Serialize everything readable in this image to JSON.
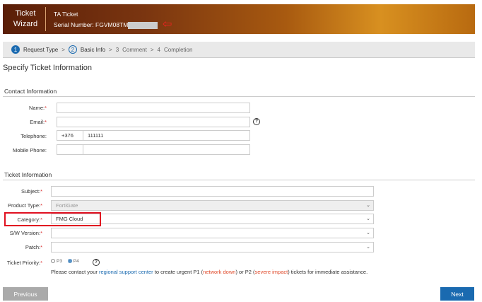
{
  "banner": {
    "title_line1": "Ticket",
    "title_line2": "Wizard",
    "ticket_type": "TA Ticket",
    "serial_label": "Serial Number: FGVM08TM"
  },
  "steps": [
    {
      "num": "1",
      "label": "Request Type"
    },
    {
      "num": "2",
      "label": "Basic Info"
    },
    {
      "num": "3",
      "label": "Comment"
    },
    {
      "num": "4",
      "label": "Completion"
    }
  ],
  "separator": ">",
  "page_title": "Specify Ticket Information",
  "contact": {
    "heading": "Contact Information",
    "name_label": "Name:",
    "email_label": "Email:",
    "telephone_label": "Telephone:",
    "telephone_code": "+376",
    "telephone_number": "111111",
    "mobile_label": "Mobile Phone:"
  },
  "ticket": {
    "heading": "Ticket Information",
    "subject_label": "Subject:",
    "product_label": "Product Type:",
    "product_value": "FortiGate",
    "category_label": "Category:",
    "category_value": "FMG Cloud",
    "sw_label": "S/W Version:",
    "patch_label": "Patch:",
    "priority_label": "Ticket Priority:",
    "p3": "P3",
    "p4": "P4",
    "selected_priority": "P4"
  },
  "note": {
    "t1": "Please contact your ",
    "link": "regional support center",
    "t2": " to create urgent P1 (",
    "p1": "network down",
    "t3": ") or P2 (",
    "p2": "severe impact",
    "t4": ") tickets for immediate assistance."
  },
  "required_mark": "*",
  "help_glyph": "?",
  "buttons": {
    "previous": "Previous",
    "next": "Next"
  },
  "colors": {
    "accent": "#1a6ab0",
    "highlight": "#e01020",
    "next_bg": "#1a6ab0",
    "prev_bg": "#aaaaaa"
  }
}
